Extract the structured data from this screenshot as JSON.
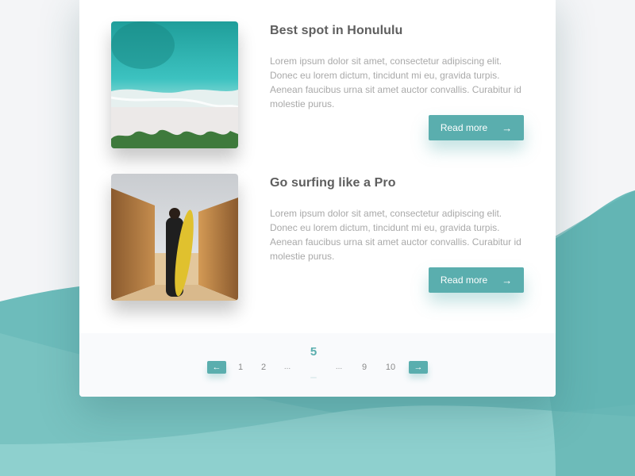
{
  "colors": {
    "accent": "#5aaeae",
    "title_text": "#5e5e5e",
    "body_text": "#a9a9a9",
    "wave_light": "#8ed0cf",
    "wave_dark": "#5fb2b1"
  },
  "posts": [
    {
      "title": "Best spot in Honululu",
      "body": "Lorem ipsum dolor sit amet, consectetur adipiscing elit. Donec eu lorem dictum, tincidunt mi eu, gravida turpis. Aenean faucibus urna sit amet auctor convallis. Curabitur id molestie purus.",
      "image": "aerial beach with turquoise water",
      "button_label": "Read more",
      "button_icon": "arrow-right-icon"
    },
    {
      "title": "Go surfing like a Pro",
      "body": "Lorem ipsum dolor sit amet, consectetur adipiscing elit. Donec eu lorem dictum, tincidunt mi eu, gravida turpis. Aenean faucibus urna sit amet auctor convallis. Curabitur id molestie purus.",
      "image": "surfer walking with yellow surfboard between wooden fences",
      "button_label": "Read more",
      "button_icon": "arrow-right-icon"
    }
  ],
  "pagination": {
    "prev_icon": "←",
    "next_icon": "→",
    "pages": [
      "1",
      "2",
      "...",
      "5",
      "...",
      "9",
      "10"
    ],
    "current": "5"
  },
  "icons": {
    "arrow_right": "→"
  }
}
